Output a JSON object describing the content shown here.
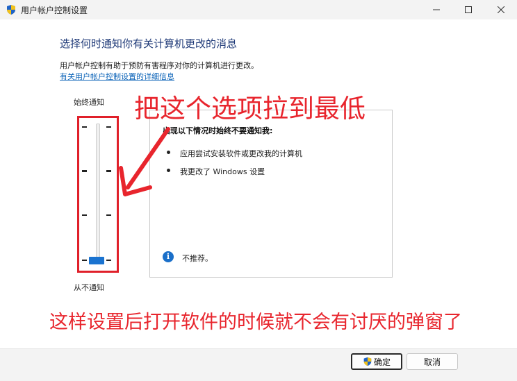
{
  "window": {
    "title": "用户帐户控制设置",
    "controls": {
      "minimize": "—",
      "maximize": "☐",
      "close": "✕"
    }
  },
  "main": {
    "heading": "选择何时通知你有关计算机更改的消息",
    "description": "用户帐户控制有助于预防有害程序对你的计算机进行更改。",
    "link": "有关用户帐户控制设置的详细信息"
  },
  "slider": {
    "label_top": "始终通知",
    "label_bottom": "从不通知",
    "levels": 4,
    "selected_level": 1
  },
  "info_panel": {
    "title": "出现以下情况时始终不要通知我:",
    "bullets": [
      "应用尝试安装软件或更改我的计算机",
      "我更改了 Windows 设置"
    ],
    "note": "不推荐。"
  },
  "annotations": {
    "top": "把这个选项拉到最低",
    "bottom": "这样设置后打开软件的时候就不会有讨厌的弹窗了",
    "color": "#e8252d"
  },
  "footer": {
    "ok_label": "确定",
    "cancel_label": "取消"
  },
  "colors": {
    "heading": "#1f3a78",
    "link": "#0b63b8",
    "slider_thumb": "#1a73d0",
    "highlight_box": "#e0202a"
  }
}
